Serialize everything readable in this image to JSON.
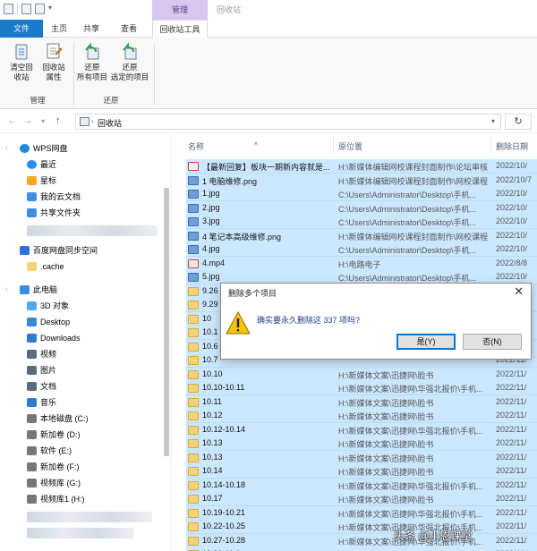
{
  "titlebar": {
    "context_group": "管理",
    "title": "回收站"
  },
  "tabs": [
    {
      "label": "文件"
    },
    {
      "label": "主页"
    },
    {
      "label": "共享"
    },
    {
      "label": "查看"
    },
    {
      "label": "回收站工具"
    }
  ],
  "ribbon": {
    "buttons": [
      {
        "label_line1": "清空回",
        "label_line2": "收站"
      },
      {
        "label_line1": "回收站",
        "label_line2": "属性"
      },
      {
        "label_line1": "还原",
        "label_line2": "所有项目"
      },
      {
        "label_line1": "还原",
        "label_line2": "选定的项目"
      }
    ],
    "groups": [
      {
        "label": "管理"
      },
      {
        "label": "还原"
      }
    ]
  },
  "address": {
    "crumb": "回收站"
  },
  "nav": {
    "items": [
      {
        "label": "WPS网盘",
        "color": "#1e88e5"
      },
      {
        "label": "最近",
        "color": "#2c8ef0"
      },
      {
        "label": "星标",
        "color": "#f5a623"
      },
      {
        "label": "我的云文档",
        "color": "#3d8ee6"
      },
      {
        "label": "共享文件夹",
        "color": "#3d8ee6"
      },
      {
        "label": "百度网盘同步空间",
        "color": "#2f6fe0"
      },
      {
        "label": ".cache",
        "color": "#f4d27a"
      },
      {
        "label": "此电脑",
        "color": "#3c8ce0"
      },
      {
        "label": "3D 对象",
        "color": "#52a9e8"
      },
      {
        "label": "Desktop",
        "color": "#3b86d9"
      },
      {
        "label": "Downloads",
        "color": "#2f7bd0"
      },
      {
        "label": "视频",
        "color": "#5a6b80"
      },
      {
        "label": "图片",
        "color": "#5a6b80"
      },
      {
        "label": "文档",
        "color": "#5a6b80"
      },
      {
        "label": "音乐",
        "color": "#2f7bd0"
      },
      {
        "label": "本地磁盘 (C:)",
        "color": "#777"
      },
      {
        "label": "新加卷 (D:)",
        "color": "#777"
      },
      {
        "label": "软件 (E:)",
        "color": "#777"
      },
      {
        "label": "新加卷 (F:)",
        "color": "#777"
      },
      {
        "label": "视频库 (G:)",
        "color": "#777"
      },
      {
        "label": "视频库1 (H:)",
        "color": "#777"
      }
    ]
  },
  "filelist": {
    "columns": {
      "name": "名称",
      "location": "原位置",
      "date": "删除日期"
    },
    "rows": [
      {
        "name": "【最新回复】板块一期新内容就是...",
        "location": "H:\\新媒体编辑网校课程封面制作\\论坛审核",
        "date": "2022/10/",
        "icon": "doc"
      },
      {
        "name": "1 电脑维修.png",
        "location": "H:\\新媒体编辑网校课程封面制作\\网校课程",
        "date": "2022/10/7",
        "icon": "img"
      },
      {
        "name": "1.jpg",
        "location": "C:\\Users\\Administrator\\Desktop\\手机...",
        "date": "2022/10/",
        "icon": "img"
      },
      {
        "name": "2.jpg",
        "location": "C:\\Users\\Administrator\\Desktop\\手机...",
        "date": "2022/10/",
        "icon": "img"
      },
      {
        "name": "3.jpg",
        "location": "C:\\Users\\Administrator\\Desktop\\手机...",
        "date": "2022/10/",
        "icon": "img"
      },
      {
        "name": "4 笔记本高级维修.png",
        "location": "H:\\新媒体编辑网校课程封面制作\\网校课程",
        "date": "2022/10/",
        "icon": "img"
      },
      {
        "name": "4.jpg",
        "location": "C:\\Users\\Administrator\\Desktop\\手机...",
        "date": "2022/10/",
        "icon": "img"
      },
      {
        "name": "4.mp4",
        "location": "H:\\电路电子",
        "date": "2022/8/8",
        "icon": "vid"
      },
      {
        "name": "5.jpg",
        "location": "C:\\Users\\Administrator\\Desktop\\手机...",
        "date": "2022/10/",
        "icon": "img"
      },
      {
        "name": "9.26",
        "location": "",
        "date": "2022/11/",
        "icon": "folder"
      },
      {
        "name": "9.29",
        "location": "",
        "date": "2022/11/",
        "icon": "folder"
      },
      {
        "name": "10",
        "location": "",
        "date": "2022/11/",
        "icon": "folder"
      },
      {
        "name": "10.1",
        "location": "",
        "date": "2022/11/",
        "icon": "folder"
      },
      {
        "name": "10.6",
        "location": "",
        "date": "2022/11/",
        "icon": "folder"
      },
      {
        "name": "10.7",
        "location": "",
        "date": "2022/11/",
        "icon": "folder"
      },
      {
        "name": "10.10",
        "location": "H:\\新媒体文案\\迅捷网\\脸书",
        "date": "2022/11/",
        "icon": "folder"
      },
      {
        "name": "10.10-10.11",
        "location": "H:\\新媒体文案\\迅捷网\\华强北报价\\手机...",
        "date": "2022/11/",
        "icon": "folder"
      },
      {
        "name": "10.11",
        "location": "H:\\新媒体文案\\迅捷网\\脸书",
        "date": "2022/11/",
        "icon": "folder"
      },
      {
        "name": "10.12",
        "location": "H:\\新媒体文案\\迅捷网\\脸书",
        "date": "2022/11/",
        "icon": "folder"
      },
      {
        "name": "10.12-10.14",
        "location": "H:\\新媒体文案\\迅捷网\\华强北报价\\手机...",
        "date": "2022/11/",
        "icon": "folder"
      },
      {
        "name": "10.13",
        "location": "H:\\新媒体文案\\迅捷网\\脸书",
        "date": "2022/11/",
        "icon": "folder"
      },
      {
        "name": "10.13",
        "location": "H:\\新媒体文案\\迅捷网\\脸书",
        "date": "2022/11/",
        "icon": "folder"
      },
      {
        "name": "10.14",
        "location": "H:\\新媒体文案\\迅捷网\\脸书",
        "date": "2022/11/",
        "icon": "folder"
      },
      {
        "name": "10.14-10.18",
        "location": "H:\\新媒体文案\\迅捷网\\华强北报价\\手机...",
        "date": "2022/11/",
        "icon": "folder"
      },
      {
        "name": "10.17",
        "location": "H:\\新媒体文案\\迅捷网\\脸书",
        "date": "2022/11/",
        "icon": "folder"
      },
      {
        "name": "10.19-10.21",
        "location": "H:\\新媒体文案\\迅捷网\\华强北报价\\手机...",
        "date": "2022/11/",
        "icon": "folder"
      },
      {
        "name": "10.22-10.25",
        "location": "H:\\新媒体文案\\迅捷网\\华强北报价\\手机...",
        "date": "2022/11/",
        "icon": "folder"
      },
      {
        "name": "10.27-10.28",
        "location": "H:\\新媒体文案\\迅捷网\\华强北报价\\手机...",
        "date": "2022/11/",
        "icon": "folder"
      },
      {
        "name": "10.30-11.1",
        "location": "H:\\新媒体文案\\迅捷网\\华强北报价\\手机...",
        "date": "2022/11/",
        "icon": "folder"
      }
    ]
  },
  "dialog": {
    "title": "删除多个项目",
    "message": "确实要永久删除这 337 项吗?",
    "yes_label": "是(Y)",
    "no_label": "否(N)",
    "close_glyph": "✕"
  },
  "watermark": {
    "text": "头条 @小恩课堂"
  }
}
